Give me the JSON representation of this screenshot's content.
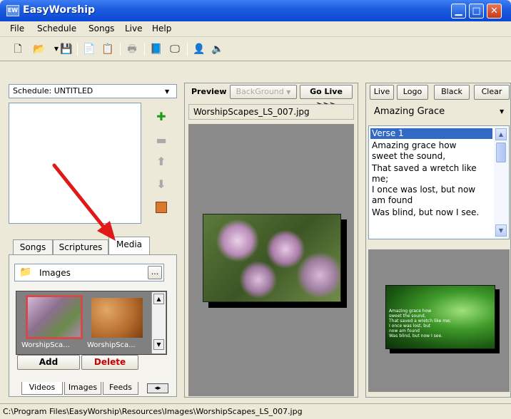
{
  "window": {
    "title": "EasyWorship",
    "app_icon": "EW",
    "minimize": "▁",
    "maximize": "□",
    "close": "✕"
  },
  "menu": [
    "File",
    "Schedule",
    "Songs",
    "Live",
    "Help"
  ],
  "toolbar": [
    "new-icon",
    "open-icon",
    "save-icon",
    "copy-icon",
    "paste-icon",
    "print-icon",
    "book-icon",
    "monitor-icon",
    "person-icon",
    "speaker-icon"
  ],
  "schedule": {
    "label": "Schedule: UNTITLED"
  },
  "library_tabs": {
    "songs": "Songs",
    "scriptures": "Scriptures",
    "media": "Media"
  },
  "media": {
    "folder": "Images",
    "folder_button": "...",
    "thumbs": [
      {
        "caption": "WorshipSca..."
      },
      {
        "caption": "WorshipSca..."
      }
    ],
    "add": "Add",
    "delete": "Delete"
  },
  "bottom_tabs": {
    "videos": "Videos",
    "images": "Images",
    "feeds": "Feeds"
  },
  "preview": {
    "label": "Preview",
    "background": "BackGround",
    "go_live": "Go Live >>>",
    "filename": "WorshipScapes_LS_007.jpg"
  },
  "live": {
    "buttons": {
      "live": "Live",
      "logo": "Logo",
      "black": "Black",
      "clear": "Clear"
    },
    "song": "Amazing Grace",
    "lyrics": [
      "Verse 1",
      "Amazing grace how",
      "sweet the sound,",
      "That saved a wretch like",
      "me;",
      "I once was lost, but now",
      "am found",
      "Was blind, but now I see."
    ],
    "output_text": [
      "Amazing grace how",
      "sweet the sound,",
      "That saved a wretch like me;",
      "I once was lost, but",
      "now am found",
      "Was blind, but now I see."
    ]
  },
  "status_bar": "C:\\Program Files\\EasyWorship\\Resources\\Images\\WorshipScapes_LS_007.jpg"
}
